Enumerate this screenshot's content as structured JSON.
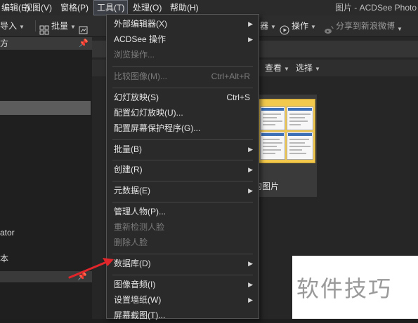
{
  "app_title": "图片 - ACDSee Photo",
  "menubar": {
    "items": [
      {
        "label": "编辑(E)"
      },
      {
        "label": "视图(V)"
      },
      {
        "label": "窗格(P)"
      },
      {
        "label": "工具(T)"
      },
      {
        "label": "处理(O)"
      },
      {
        "label": "帮助(H)"
      }
    ]
  },
  "toolbar": {
    "import_label": "导入",
    "batch_label": "批量",
    "operate_label": "操作",
    "share_label": "分享到新浪微博"
  },
  "left_panel": {
    "header_label": "方",
    "item_ator": "ator",
    "item_ben": "本"
  },
  "main": {
    "view_label": "查看",
    "select_label": "选择",
    "thumb_label": "的图片"
  },
  "tools_menu": {
    "external_editor": "外部编辑器(X)",
    "acdsee_ops": "ACDSee 操作",
    "browse_ops": "浏览操作...",
    "compare_images": "比较图像(M)...",
    "compare_shortcut": "Ctrl+Alt+R",
    "slideshow": "幻灯放映(S)",
    "slideshow_shortcut": "Ctrl+S",
    "configure_slideshow": "配置幻灯放映(U)...",
    "configure_screensaver": "配置屏幕保护程序(G)...",
    "batch": "批量(B)",
    "create": "创建(R)",
    "metadata": "元数据(E)",
    "manage_people": "管理人物(P)...",
    "redetect_faces": "重新检测人脸",
    "delete_faces": "删除人脸",
    "database": "数据库(D)",
    "image_audio": "图像音频(I)",
    "set_wallpaper": "设置墙纸(W)",
    "screenshot": "屏幕截图(T)..."
  },
  "watermark": "软件技巧",
  "colors": {
    "arrow": "#e0262a",
    "menu_bg": "#2a2a2a",
    "thumb_folder": "#f2c94c"
  }
}
